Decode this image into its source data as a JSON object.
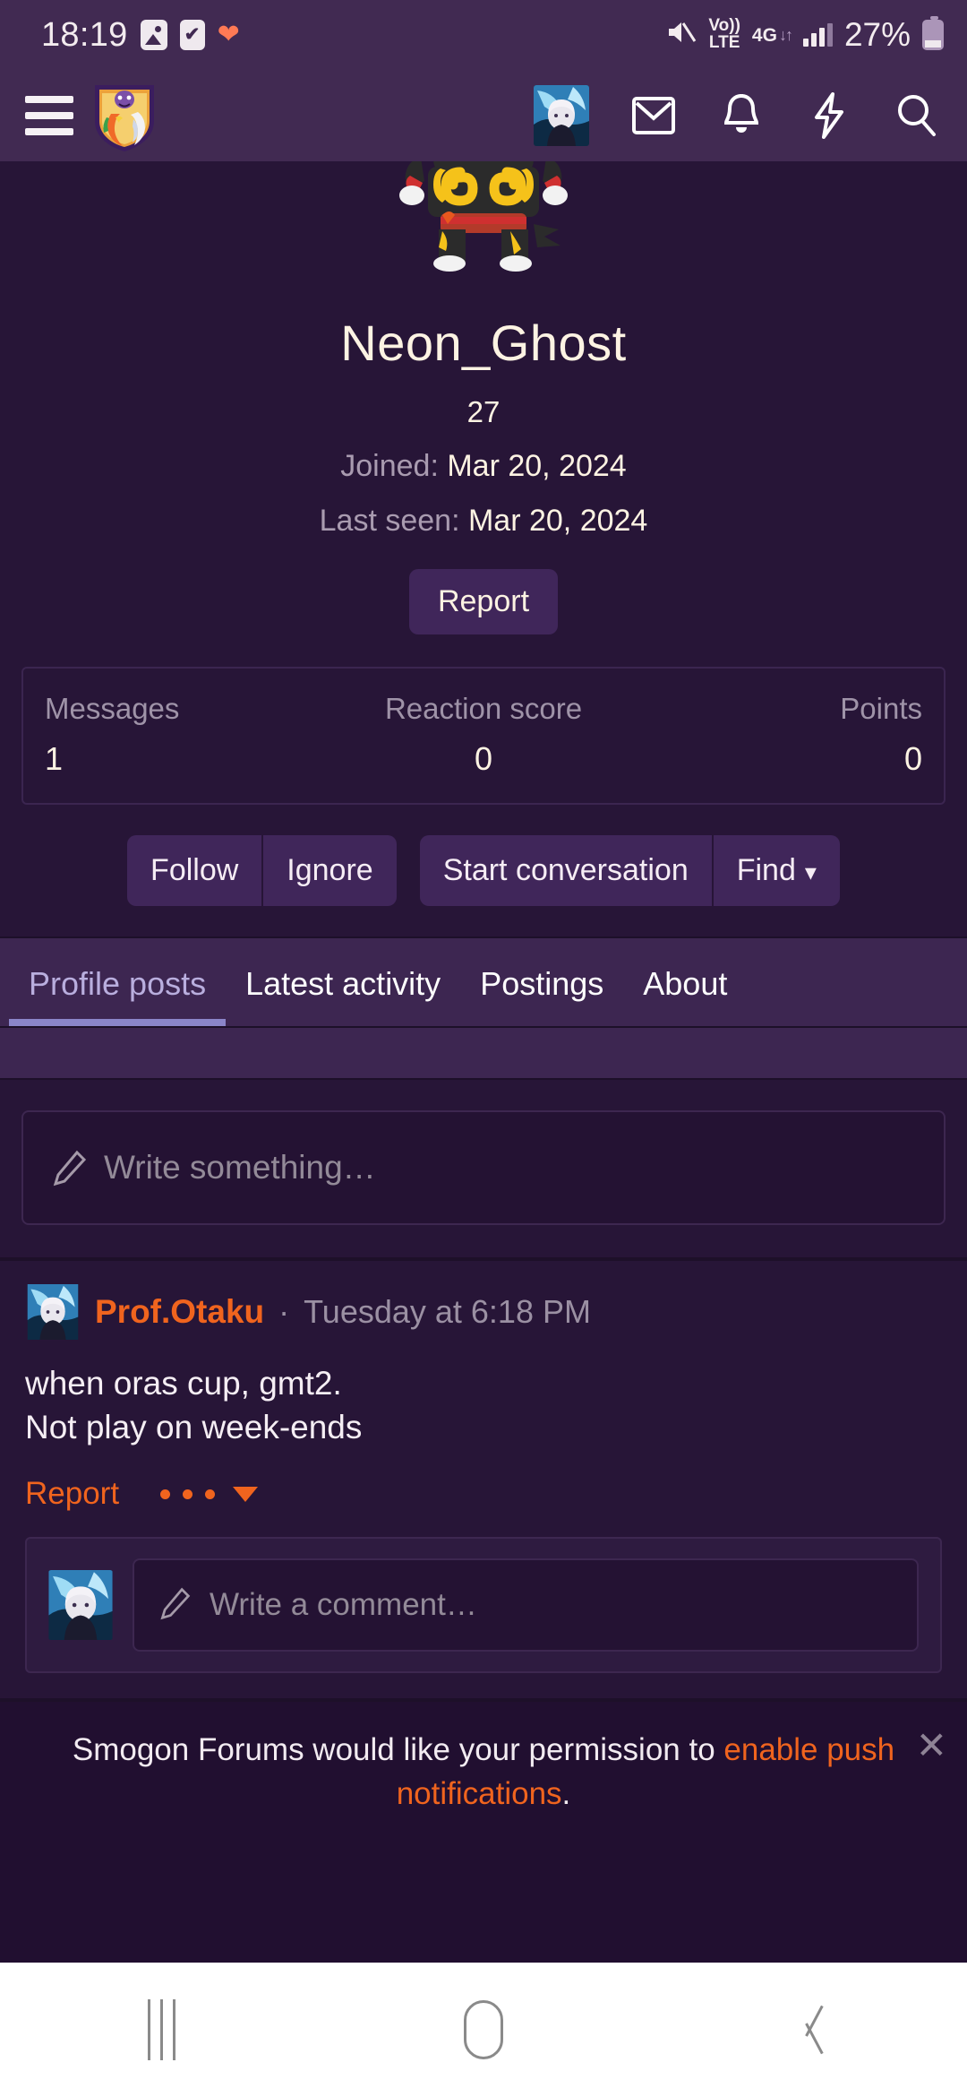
{
  "status_bar": {
    "time": "18:19",
    "icons_left": [
      "photos-icon",
      "tasks-icon",
      "heart-icon"
    ],
    "mute_icon": "mute-icon",
    "volte": "Vo))",
    "volte_sub": "LTE",
    "network": "4G",
    "network_arrows": "↓↑",
    "battery_percent": "27%"
  },
  "header": {
    "menu_icon": "hamburger-menu-icon",
    "logo": "smogon-shield-logo",
    "avatar": "user-avatar",
    "icons": [
      "inbox-icon",
      "alerts-bell-icon",
      "lightning-icon",
      "search-icon"
    ]
  },
  "profile": {
    "banner_sprite": "emboar-pokemon-sprite",
    "username": "Neon_Ghost",
    "user_title": "27",
    "joined_label": "Joined:",
    "joined_value": "Mar 20, 2024",
    "last_seen_label": "Last seen:",
    "last_seen_value": "Mar 20, 2024",
    "report_label": "Report"
  },
  "stats": [
    {
      "label": "Messages",
      "value": "1"
    },
    {
      "label": "Reaction score",
      "value": "0"
    },
    {
      "label": "Points",
      "value": "0"
    }
  ],
  "actions": {
    "follow": "Follow",
    "ignore": "Ignore",
    "start_conversation": "Start conversation",
    "find": "Find",
    "find_caret": "▾"
  },
  "tabs": [
    {
      "label": "Profile posts",
      "active": true
    },
    {
      "label": "Latest activity",
      "active": false
    },
    {
      "label": "Postings",
      "active": false
    },
    {
      "label": "About",
      "active": false
    }
  ],
  "composer": {
    "pencil_icon": "pencil-icon",
    "placeholder": "Write something…"
  },
  "post": {
    "avatar": "prof-otaku-avatar",
    "author": "Prof.Otaku",
    "separator": "·",
    "timestamp": "Tuesday at 6:18 PM",
    "line1": "when oras cup, gmt2.",
    "line2": "Not play on week-ends",
    "report_label": "Report",
    "more_icon": "more-options-icon",
    "comment_avatar": "current-user-avatar",
    "comment_placeholder": "Write a comment…"
  },
  "push_banner": {
    "text_before": "Smogon Forums would like your permission to ",
    "link_text": "enable push notifications",
    "text_after": ".",
    "close_icon": "✕"
  },
  "nav_bar": {
    "recents": "recents-icon",
    "home": "home-icon",
    "back": "back-icon"
  },
  "colors": {
    "header_bg": "#412a52",
    "body_bg": "#271537",
    "accent_orange": "#f0641e",
    "tab_active": "#8b85c9",
    "cream_text": "#fdf3e3"
  }
}
